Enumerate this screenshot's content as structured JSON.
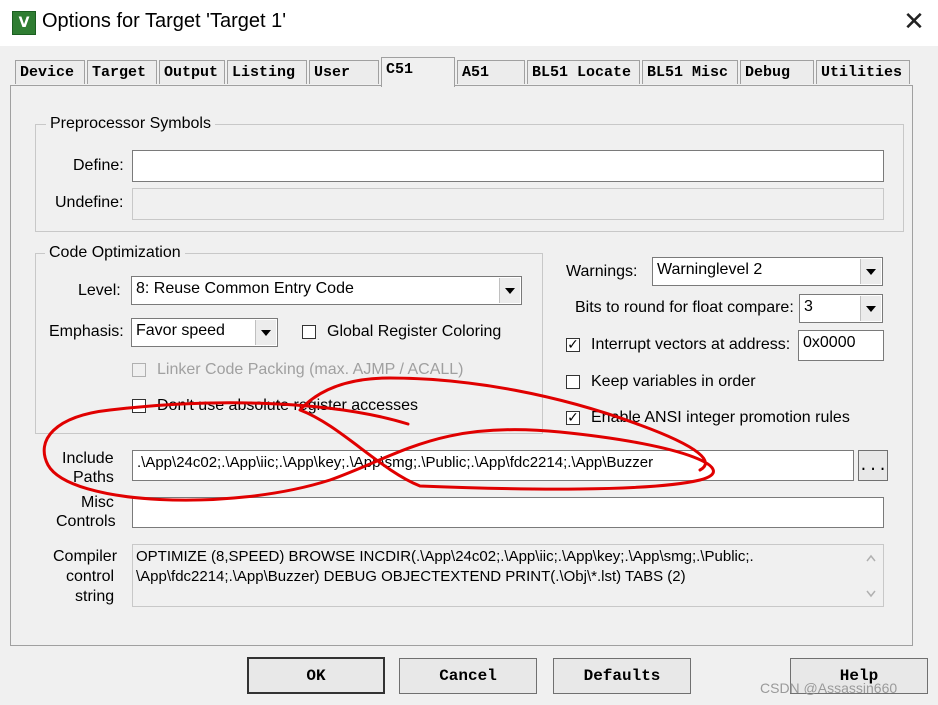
{
  "window": {
    "title": "Options for Target 'Target 1'",
    "app_icon": "V",
    "close_glyph": "✕"
  },
  "tabs": [
    {
      "label": "Device"
    },
    {
      "label": "Target"
    },
    {
      "label": "Output"
    },
    {
      "label": "Listing"
    },
    {
      "label": "User"
    },
    {
      "label": "C51",
      "active": true
    },
    {
      "label": "A51"
    },
    {
      "label": "BL51 Locate"
    },
    {
      "label": "BL51 Misc"
    },
    {
      "label": "Debug"
    },
    {
      "label": "Utilities"
    }
  ],
  "preprocessor": {
    "title": "Preprocessor Symbols",
    "define_label": "Define:",
    "define_value": "",
    "undefine_label": "Undefine:",
    "undefine_value": ""
  },
  "code_optimization": {
    "title": "Code Optimization",
    "level_label": "Level:",
    "level_value": "8: Reuse Common Entry Code",
    "emphasis_label": "Emphasis:",
    "emphasis_value": "Favor speed",
    "global_register_coloring": {
      "label": "Global Register Coloring",
      "checked": false
    },
    "linker_code_packing": {
      "label": "Linker Code Packing (max. AJMP / ACALL)",
      "checked": false,
      "enabled": false
    },
    "no_absolute_register": {
      "label": "Don't use absolute register accesses",
      "checked": false
    }
  },
  "right_options": {
    "warnings_label": "Warnings:",
    "warnings_value": "Warninglevel 2",
    "bits_label": "Bits to round for float compare:",
    "bits_value": "3",
    "interrupt_vectors": {
      "label": "Interrupt vectors at address:",
      "checked": true,
      "value": "0x0000"
    },
    "keep_variables": {
      "label": "Keep variables in order",
      "checked": false
    },
    "ansi_promotion": {
      "label": "Enable ANSI integer promotion rules",
      "checked": true
    }
  },
  "include_paths": {
    "label_line1": "Include",
    "label_line2": "Paths",
    "value": ".\\App\\24c02;.\\App\\iic;.\\App\\key;.\\App\\smg;.\\Public;.\\App\\fdc2214;.\\App\\Buzzer",
    "browse_label": "..."
  },
  "misc_controls": {
    "label_line1": "Misc",
    "label_line2": "Controls",
    "value": ""
  },
  "compiler_string": {
    "label_line1": "Compiler",
    "label_line2": "control",
    "label_line3": "string",
    "line1": "OPTIMIZE (8,SPEED) BROWSE INCDIR(.\\App\\24c02;.\\App\\iic;.\\App\\key;.\\App\\smg;.\\Public;.",
    "line2": "\\App\\fdc2214;.\\App\\Buzzer) DEBUG OBJECTEXTEND PRINT(.\\Obj\\*.lst) TABS (2)"
  },
  "buttons": {
    "ok": "OK",
    "cancel": "Cancel",
    "defaults": "Defaults",
    "help": "Help"
  },
  "watermark": "CSDN @Assassin660",
  "annotation_color": "#e00000",
  "check_glyph": "✓"
}
